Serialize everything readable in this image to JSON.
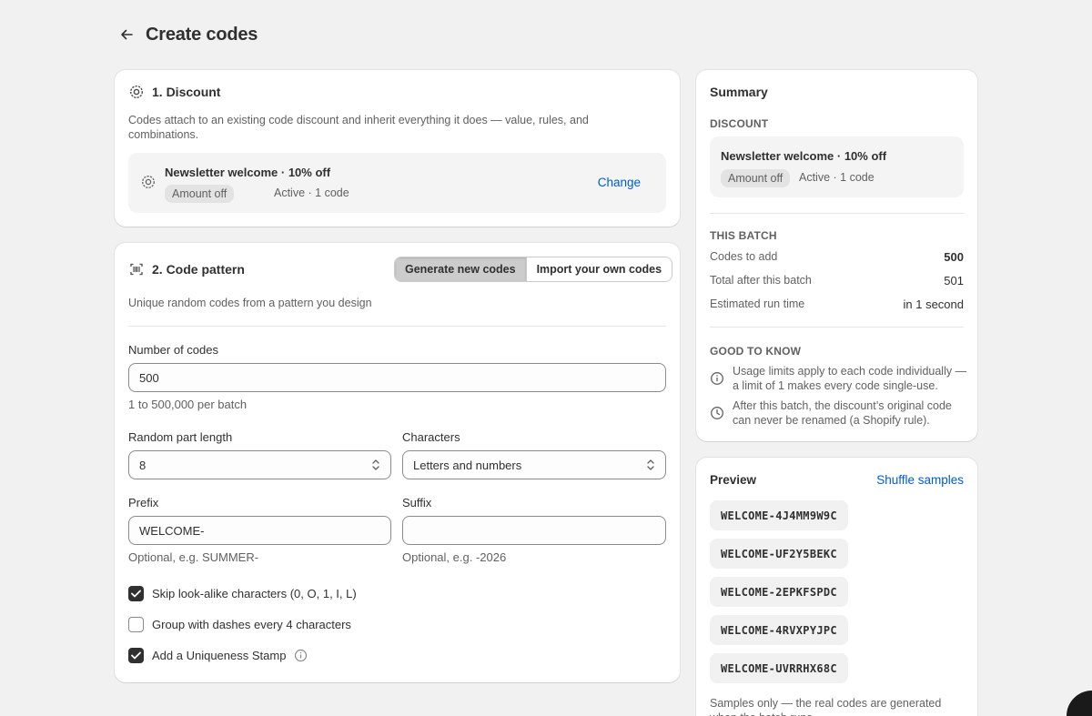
{
  "header": {
    "title": "Create codes",
    "back_icon": "arrow-left-icon"
  },
  "discount": {
    "title": "1. Discount",
    "description": "Codes attach to an existing code discount and inherit everything it does — value, rules, and combinations.",
    "selected": {
      "name": "Newsletter welcome · 10% off",
      "type_badge": "Amount off",
      "status": "Active · 1 code"
    },
    "change_label": "Change"
  },
  "pattern": {
    "title": "2. Code pattern",
    "tabs": [
      {
        "label": "Generate new codes",
        "active": true
      },
      {
        "label": "Import your own codes",
        "active": false
      }
    ],
    "description": "Unique random codes from a pattern you design",
    "number_of_codes": {
      "label": "Number of codes",
      "value": "500",
      "help": "1 to 500,000 per batch"
    },
    "random_length": {
      "label": "Random part length",
      "value": "8"
    },
    "characters": {
      "label": "Characters",
      "value": "Letters and numbers"
    },
    "prefix": {
      "label": "Prefix",
      "value": "WELCOME-",
      "help": "Optional, e.g. SUMMER-"
    },
    "suffix": {
      "label": "Suffix",
      "value": "",
      "help": "Optional, e.g. -2026"
    },
    "options": [
      {
        "label": "Skip look-alike characters (0, O, 1, I, L)",
        "checked": true
      },
      {
        "label": "Group with dashes every 4 characters",
        "checked": false
      },
      {
        "label": "Add a Uniqueness Stamp",
        "checked": true
      }
    ]
  },
  "summary": {
    "title": "Summary",
    "discount_label": "DISCOUNT",
    "discount_name": "Newsletter welcome · 10% off",
    "discount_badge": "Amount off",
    "discount_status": "Active · 1 code",
    "batch_label": "THIS BATCH",
    "rows": [
      {
        "key": "Codes to add",
        "value": "500"
      },
      {
        "key": "Total after this batch",
        "value": "501"
      },
      {
        "key": "Estimated run time",
        "value": "in 1 second"
      }
    ],
    "good_label": "GOOD TO KNOW",
    "notes": [
      "Usage limits apply to each code individually — a limit of 1 makes every code single-use.",
      "After this batch, the discount’s original code can never be renamed (a Shopify rule)."
    ]
  },
  "preview": {
    "title": "Preview",
    "shuffle_label": "Shuffle samples",
    "samples": [
      "WELCOME-4J4MM9W9C",
      "WELCOME-UF2Y5BEKC",
      "WELCOME-2EPKFSPDC",
      "WELCOME-4RVXPYJPC",
      "WELCOME-UVRRHX68C"
    ],
    "footer": "Samples only — the real codes are generated when the batch runs."
  },
  "colors": {
    "accent_link": "#005bd3",
    "page_bg": "#f1f1f1",
    "checkbox_on": "#303030"
  }
}
